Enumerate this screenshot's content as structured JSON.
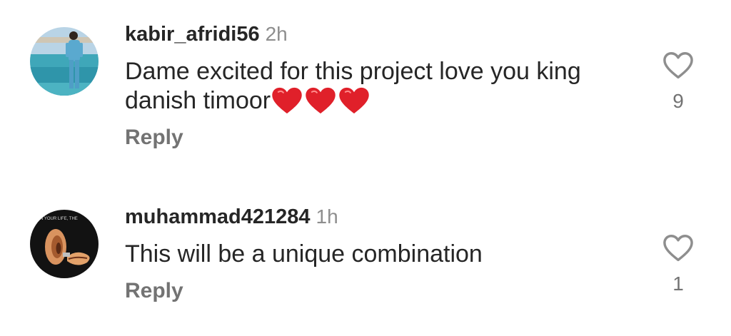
{
  "comments": [
    {
      "username": "kabir_afridi56",
      "time": "2h",
      "text": "Dame excited for this project love you king danish timoor",
      "emoji": "red-heart-x3",
      "reply_label": "Reply",
      "like_count": "9",
      "avatar": "avatar-man-standing-by-lake"
    },
    {
      "username": "muhammad421284",
      "time": "1h",
      "text": "This will be a unique combination",
      "reply_label": "Reply",
      "like_count": "1",
      "avatar": "avatar-ear-and-lips-artwork",
      "avatar_caption": "N YOUR LIFE, THE"
    }
  ],
  "colors": {
    "primary_text": "#262626",
    "secondary_text": "#8e8e8e",
    "reply_text": "#737373",
    "heart_red": "#e0202a",
    "like_outline": "#8e8e8e"
  },
  "icons": {
    "like": "heart-outline-icon",
    "emoji": "red-heart-icon"
  }
}
